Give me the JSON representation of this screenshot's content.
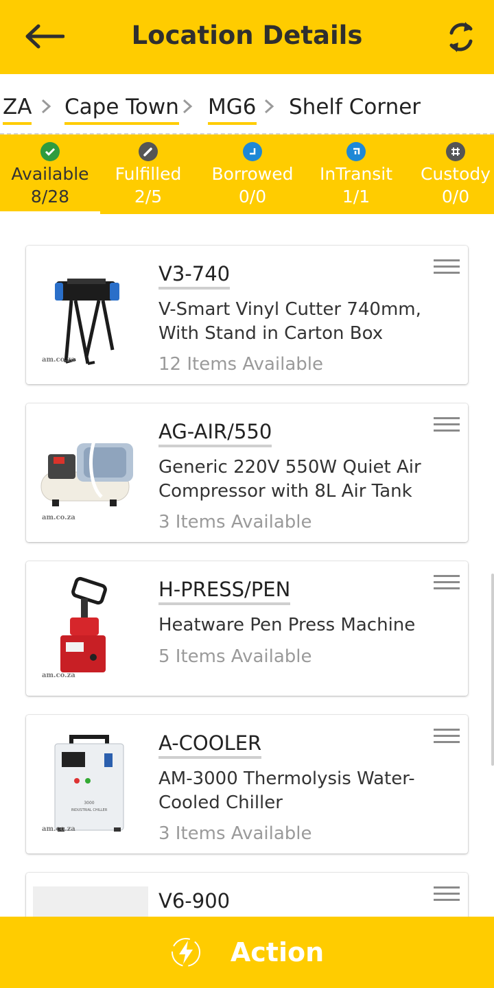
{
  "header": {
    "title": "Location Details",
    "back_icon": "arrow-left-icon",
    "refresh_icon": "refresh-icon",
    "background": "#FFCC00"
  },
  "breadcrumb": {
    "items": [
      "ZA",
      "Cape Town",
      "MG6",
      "Shelf Corner"
    ]
  },
  "tabs": [
    {
      "label": "Available",
      "count": "8/28",
      "icon": "check-circle-icon",
      "color": "#2e9b3f",
      "active": true
    },
    {
      "label": "Fulfilled",
      "count": "2/5",
      "icon": "pencil-circle-icon",
      "color": "#555555",
      "active": false
    },
    {
      "label": "Borrowed",
      "count": "0/0",
      "icon": "borrow-icon",
      "color": "#1e88d6",
      "active": false
    },
    {
      "label": "InTransit",
      "count": "1/1",
      "icon": "transit-icon",
      "color": "#1e88d6",
      "active": false
    },
    {
      "label": "Custody",
      "count": "0/0",
      "icon": "hash-icon",
      "color": "#555555",
      "active": false
    }
  ],
  "items": [
    {
      "code": "V3-740",
      "description": "V-Smart Vinyl Cutter 740mm, With Stand in Carton Box",
      "availability": "12 Items Available",
      "watermark": "am.co.za"
    },
    {
      "code": "AG-AIR/550",
      "description": "Generic 220V 550W Quiet Air Compressor with 8L Air Tank",
      "availability": "3 Items Available",
      "watermark": "am.co.za"
    },
    {
      "code": "H-PRESS/PEN",
      "description": "Heatware Pen Press Machine",
      "availability": "5 Items Available",
      "watermark": "am.co.za"
    },
    {
      "code": "A-COOLER",
      "description": "AM-3000 Thermolysis Water-Cooled Chiller",
      "availability": "3 Items Available",
      "watermark": "am.co.za",
      "product_text": "INDUSTRIAL CHILLER"
    },
    {
      "code": "V6-900",
      "description": "",
      "availability": ""
    }
  ],
  "footer": {
    "action_label": "Action",
    "icon": "lightning-icon"
  }
}
